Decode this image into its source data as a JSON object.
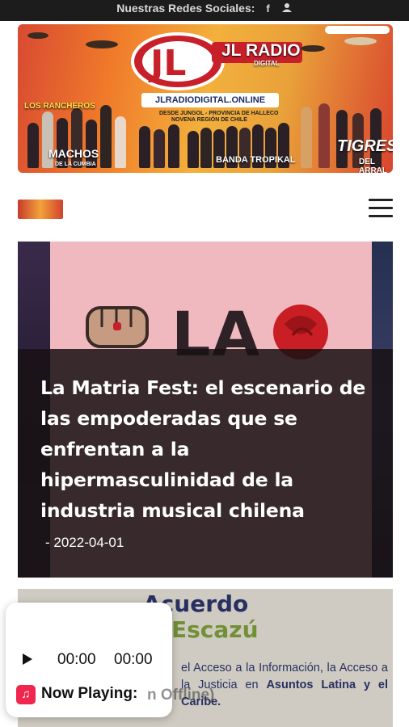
{
  "topbar": {
    "social_label": "Nuestras Redes Sociales:",
    "icons": [
      "facebook-icon",
      "user-group-icon"
    ]
  },
  "banner": {
    "brand": "JL RADIO",
    "brand_sub": "DIGITAL",
    "url": "JLRADIODIGITAL.ONLINE",
    "line1": "DESDE JUNGOL - PROVINCIA DE HALLECO",
    "line2": "NOVENA REGIÓN DE CHILE",
    "left_group": "LOS RANCHEROS",
    "group_a": "MACHOS",
    "group_a_sub": "DE LA CUMBIA",
    "group_b": "BANDA TROPIKAL",
    "group_c": "TIGRES",
    "group_c_sub": "DEL ARRAL"
  },
  "nav": {
    "menu_icon": "hamburger-icon"
  },
  "articles": [
    {
      "image_text": "LA",
      "title": "La Matria Fest: el escenario de las empoderadas que se enfrentan a la hipermasculinidad de la industria musical chilena",
      "date": "- 2022-04-01"
    },
    {
      "heading1": "Acuerdo",
      "heading2": "Escazú",
      "body_plain": "el Acceso a la Información, la ",
      "body_plain2": "Acceso a la Justicia en ",
      "body_bold": "Asuntos",
      "body_bold2": "Latina y el Caribe."
    }
  ],
  "player": {
    "time_current": "00:00",
    "time_total": "00:00",
    "now_playing_label": "Now Playing:",
    "status_suffix": "n Offline)"
  },
  "colors": {
    "topbar": "#1c1c1c",
    "overlay": "#181214",
    "music_badge": "#f1264e",
    "escazu_blue": "#2a3468",
    "escazu_green": "#7a9a3a"
  }
}
